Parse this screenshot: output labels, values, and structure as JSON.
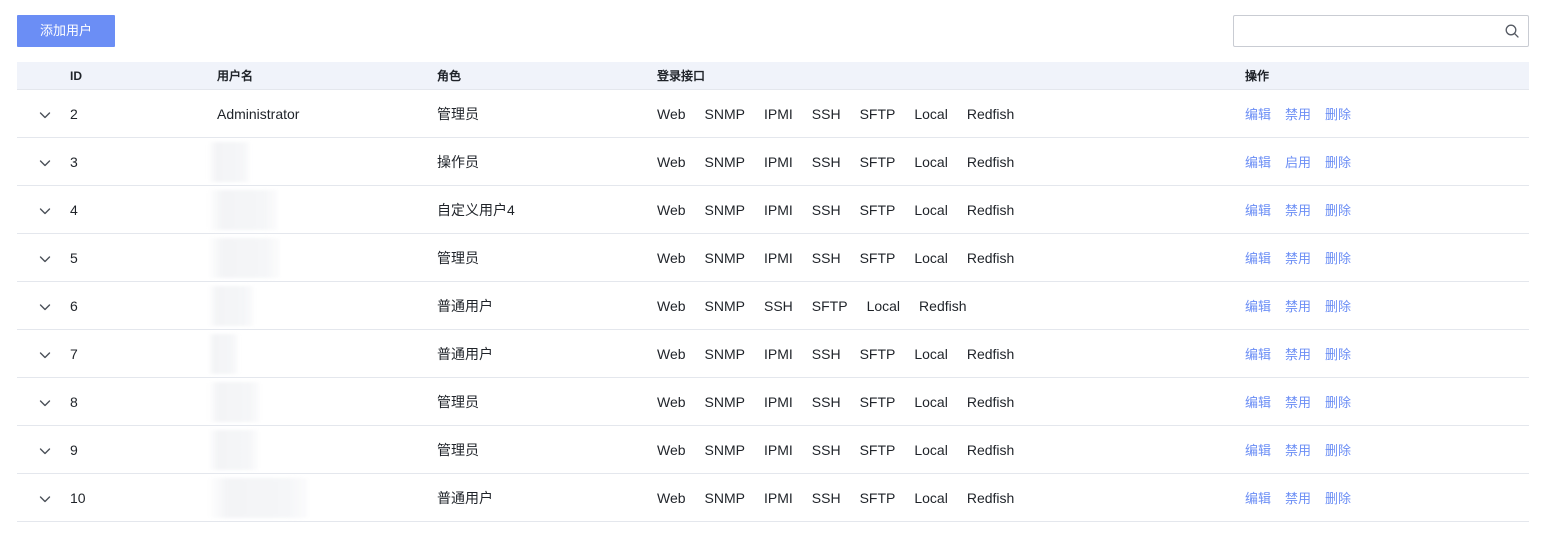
{
  "toolbar": {
    "add_user_label": "添加用户",
    "search_placeholder": "",
    "search_value": ""
  },
  "table": {
    "headers": {
      "id": "ID",
      "username": "用户名",
      "role": "角色",
      "login_interfaces": "登录接口",
      "actions": "操作"
    },
    "rows": [
      {
        "id": "2",
        "username": "Administrator",
        "username_obscured": false,
        "role": "管理员",
        "interfaces": [
          "Web",
          "SNMP",
          "IPMI",
          "SSH",
          "SFTP",
          "Local",
          "Redfish"
        ],
        "actions": [
          "编辑",
          "禁用",
          "删除"
        ]
      },
      {
        "id": "3",
        "username": "",
        "username_obscured": true,
        "role": "操作员",
        "interfaces": [
          "Web",
          "SNMP",
          "IPMI",
          "SSH",
          "SFTP",
          "Local",
          "Redfish"
        ],
        "actions": [
          "编辑",
          "启用",
          "删除"
        ]
      },
      {
        "id": "4",
        "username": "",
        "username_obscured": true,
        "role": "自定义用户4",
        "interfaces": [
          "Web",
          "SNMP",
          "IPMI",
          "SSH",
          "SFTP",
          "Local",
          "Redfish"
        ],
        "actions": [
          "编辑",
          "禁用",
          "删除"
        ]
      },
      {
        "id": "5",
        "username": "",
        "username_obscured": true,
        "role": "管理员",
        "interfaces": [
          "Web",
          "SNMP",
          "IPMI",
          "SSH",
          "SFTP",
          "Local",
          "Redfish"
        ],
        "actions": [
          "编辑",
          "禁用",
          "删除"
        ]
      },
      {
        "id": "6",
        "username": "",
        "username_obscured": true,
        "role": "普通用户",
        "interfaces": [
          "Web",
          "SNMP",
          "SSH",
          "SFTP",
          "Local",
          "Redfish"
        ],
        "actions": [
          "编辑",
          "禁用",
          "删除"
        ]
      },
      {
        "id": "7",
        "username": "",
        "username_obscured": true,
        "role": "普通用户",
        "interfaces": [
          "Web",
          "SNMP",
          "IPMI",
          "SSH",
          "SFTP",
          "Local",
          "Redfish"
        ],
        "actions": [
          "编辑",
          "禁用",
          "删除"
        ]
      },
      {
        "id": "8",
        "username": "",
        "username_obscured": true,
        "role": "管理员",
        "interfaces": [
          "Web",
          "SNMP",
          "IPMI",
          "SSH",
          "SFTP",
          "Local",
          "Redfish"
        ],
        "actions": [
          "编辑",
          "禁用",
          "删除"
        ]
      },
      {
        "id": "9",
        "username": "",
        "username_obscured": true,
        "role": "管理员",
        "interfaces": [
          "Web",
          "SNMP",
          "IPMI",
          "SSH",
          "SFTP",
          "Local",
          "Redfish"
        ],
        "actions": [
          "编辑",
          "禁用",
          "删除"
        ]
      },
      {
        "id": "10",
        "username": "",
        "username_obscured": true,
        "role": "普通用户",
        "interfaces": [
          "Web",
          "SNMP",
          "IPMI",
          "SSH",
          "SFTP",
          "Local",
          "Redfish"
        ],
        "actions": [
          "编辑",
          "禁用",
          "删除"
        ]
      }
    ]
  },
  "icons": {
    "search": "search-icon",
    "expand": "chevron-down-icon"
  },
  "colors": {
    "accent": "#6b8ef5",
    "header_bg": "#f0f3fa",
    "row_border": "#e4e7ed",
    "text": "#1f2329"
  }
}
